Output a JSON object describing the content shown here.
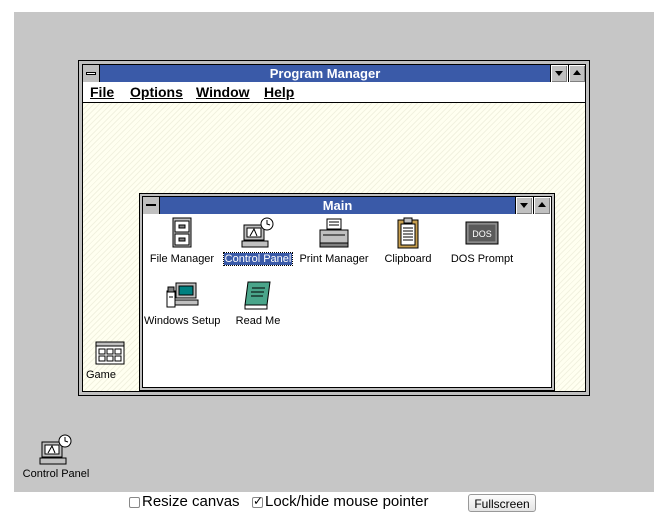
{
  "program_manager": {
    "title": "Program Manager",
    "menu": [
      "File",
      "Options",
      "Window",
      "Help"
    ]
  },
  "main_group": {
    "title": "Main",
    "icons": [
      {
        "label": "File Manager",
        "icon": "file-cabinet-icon"
      },
      {
        "label": "Control Panel",
        "icon": "control-panel-icon",
        "selected": true
      },
      {
        "label": "Print Manager",
        "icon": "printer-icon"
      },
      {
        "label": "Clipboard",
        "icon": "clipboard-icon"
      },
      {
        "label": "DOS Prompt",
        "icon": "dos-icon",
        "icon_text": "DOS"
      },
      {
        "label": "Windows Setup",
        "icon": "setup-icon"
      },
      {
        "label": "Read Me",
        "icon": "readme-book-icon"
      }
    ]
  },
  "games_group_icon": {
    "label": "Games",
    "visible_label": "Game"
  },
  "desktop_icon": {
    "label": "Control Panel",
    "icon": "control-panel-icon"
  },
  "controls": {
    "resize_canvas": {
      "label": "Resize canvas",
      "checked": false
    },
    "lock_pointer": {
      "label": "Lock/hide mouse pointer",
      "checked": true
    },
    "fullscreen": "Fullscreen"
  },
  "colors": {
    "titlebar": "#3a5aa8",
    "canvas": "#c6c6c6",
    "client": "#fffff0"
  }
}
